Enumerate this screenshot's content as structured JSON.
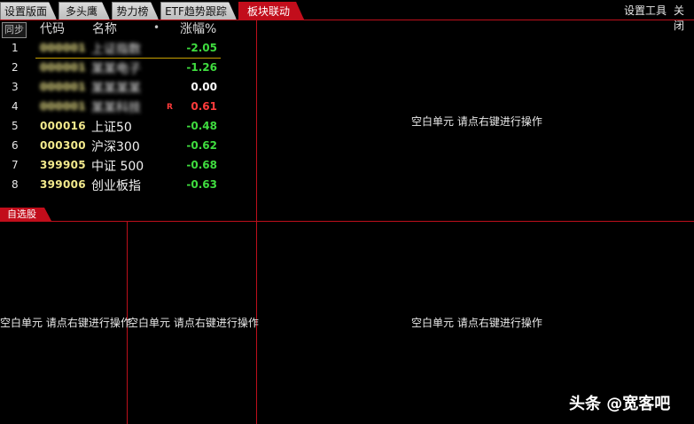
{
  "tabs": [
    {
      "label": "设置版面",
      "active": false
    },
    {
      "label": "多头鹰",
      "active": false
    },
    {
      "label": "势力榜",
      "active": false
    },
    {
      "label": "ETF趋势跟踪",
      "active": false
    },
    {
      "label": "板块联动",
      "active": true
    }
  ],
  "top_right": {
    "settings_tool": "设置工具",
    "close": "关闭"
  },
  "table": {
    "sync_label": "同步",
    "headers": {
      "code": "代码",
      "name": "名称",
      "dot": "•",
      "change": "涨幅%"
    },
    "rows": [
      {
        "index": "1",
        "code": "000001",
        "name": "上证指数",
        "change": "-2.05",
        "color": "#3fdc3f",
        "blurred": true,
        "flag": ""
      },
      {
        "index": "2",
        "code": "000001",
        "name": "某某电子",
        "change": "-1.26",
        "color": "#3fdc3f",
        "blurred": true,
        "flag": ""
      },
      {
        "index": "3",
        "code": "000001",
        "name": "某某某某",
        "change": "0.00",
        "color": "#ffffff",
        "blurred": true,
        "flag": ""
      },
      {
        "index": "4",
        "code": "000001",
        "name": "某某科技",
        "change": "0.61",
        "color": "#ff3b3b",
        "blurred": true,
        "flag": "R"
      },
      {
        "index": "5",
        "code": "000016",
        "name": "上证50",
        "change": "-0.48",
        "color": "#3fdc3f",
        "blurred": false,
        "flag": ""
      },
      {
        "index": "6",
        "code": "000300",
        "name": "沪深300",
        "change": "-0.62",
        "color": "#3fdc3f",
        "blurred": false,
        "flag": ""
      },
      {
        "index": "7",
        "code": "399905",
        "name": "中证 500",
        "change": "-0.68",
        "color": "#3fdc3f",
        "blurred": false,
        "flag": ""
      },
      {
        "index": "8",
        "code": "399006",
        "name": "创业板指",
        "change": "-0.63",
        "color": "#3fdc3f",
        "blurred": false,
        "flag": ""
      }
    ]
  },
  "section_tab": "自选股",
  "placeholders": {
    "top_right_pane": "空白单元 请点右键进行操作",
    "bottom_left_pane": "空白单元 请点右键进行操作",
    "bottom_mid_pane": "空白单元 请点右键进行操作",
    "bottom_right_pane": "空白单元 请点右键进行操作"
  },
  "watermark": "头条 @宽客吧"
}
